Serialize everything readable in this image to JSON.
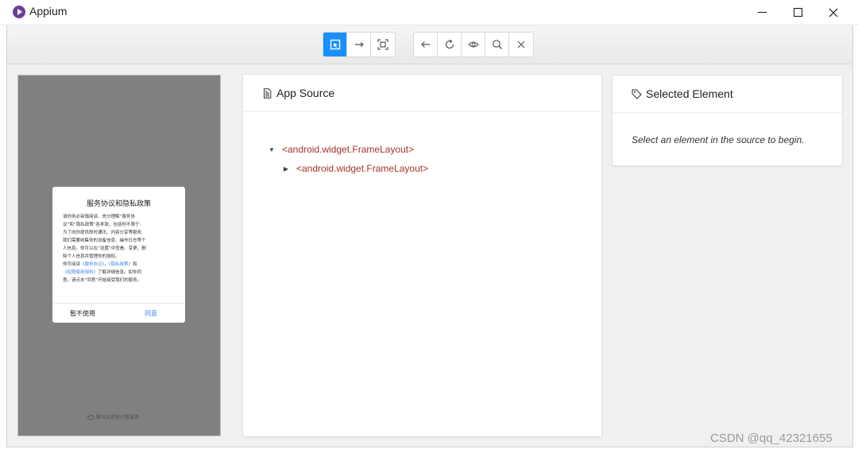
{
  "window": {
    "title": "Appium"
  },
  "toolbar": {
    "mode_buttons": [
      {
        "icon": "select-elements-icon",
        "active": true
      },
      {
        "icon": "swipe-arrow-icon",
        "active": false
      },
      {
        "icon": "tap-by-coordinates-icon",
        "active": false
      }
    ],
    "action_buttons": [
      {
        "icon": "back-arrow-icon"
      },
      {
        "icon": "refresh-icon"
      },
      {
        "icon": "eye-icon"
      },
      {
        "icon": "search-icon"
      },
      {
        "icon": "close-icon"
      }
    ]
  },
  "device": {
    "dialog": {
      "title": "服务协议和隐私政策",
      "body": [
        {
          "text": "请你务必审慎阅读、充分理解“服务协",
          "link": false
        },
        {
          "text": "议”和“隐私政策”各条款，包括但不限于:",
          "link": false
        },
        {
          "text": "为了向你提供即时通讯、内容分享等服务,",
          "link": false
        },
        {
          "text": "我们需要收集你的设备信息、操作日志等个",
          "link": false
        },
        {
          "text": "人信息。你可以在“设置”中查看、变更、删",
          "link": false
        },
        {
          "text": "除个人信息并管理你的授权。",
          "link": false
        }
      ],
      "body_line7_prefix": "你可阅读",
      "link_service": "《服务协议》",
      "comma": "，",
      "link_privacy": "《隐私政策》",
      "and": "和",
      "link_permissions": "《权限使用规则》",
      "line8_suffix": "了解详细信息。如你同",
      "line9": "意，请点击“同意”开始接受我们的服务。",
      "decline_label": "暂不使用",
      "agree_label": "同意"
    },
    "footer_text": "腾讯云提供计算服务"
  },
  "source_panel": {
    "title": "App Source",
    "tree": [
      {
        "label": "<android.widget.FrameLayout>",
        "expanded": true
      },
      {
        "label": "<android.widget.FrameLayout>",
        "expanded": false
      }
    ]
  },
  "selected_panel": {
    "title": "Selected Element",
    "hint": "Select an element in the source to begin."
  },
  "watermark": "CSDN @qq_42321655",
  "colors": {
    "accent": "#1890ff",
    "tag": "#a3332c",
    "device_bg": "#808080",
    "link": "#3b87e6"
  }
}
